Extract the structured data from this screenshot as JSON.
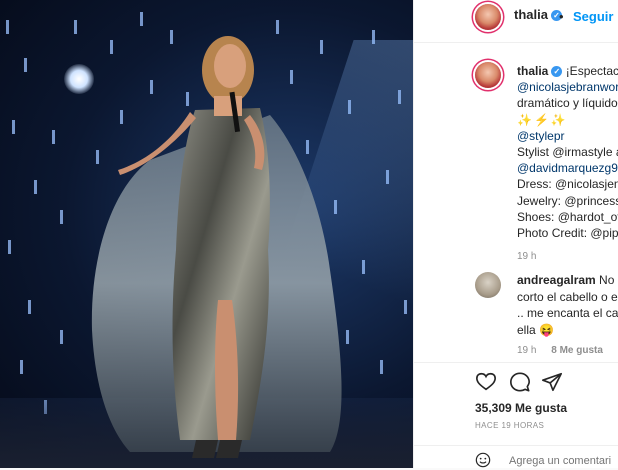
{
  "post": {
    "username": "thalia",
    "follow_label": "Seguir",
    "dot": "•"
  },
  "caption": {
    "username": "thalia",
    "lines": [
      "¡Espectacu",
      "@nicolasjebranworl",
      "dramático y líquido",
      "✨⚡✨",
      "@stylepr",
      "Stylist @irmastyle a",
      "@davidmarquezg92",
      "Dress: @nicolasjenr",
      "Jewelry: @princessr",
      "Shoes: @hardot_off",
      "Photo Credit: @pipe"
    ],
    "time": "19 h"
  },
  "comment": {
    "username": "andreagalram",
    "line1": "No e",
    "line2": "corto el cabello o e",
    "line3": ".. me encanta el cab",
    "line4": "ella 😝",
    "time": "19 h",
    "likes": "8 Me gusta",
    "reply": "Re"
  },
  "stats": {
    "likes": "35,309 Me gusta",
    "time_ago": "HACE 19 HORAS"
  },
  "input": {
    "placeholder": "Agrega un comentari"
  },
  "icons": {
    "like": "heart-icon",
    "comment": "comment-icon",
    "share": "paper-plane-icon",
    "emoji": "smile-icon",
    "next": "chevron-right-icon"
  },
  "colors": {
    "link": "#00376b",
    "follow": "#0095f6",
    "meta": "#8e8e8e",
    "verified": "#3897f0"
  }
}
